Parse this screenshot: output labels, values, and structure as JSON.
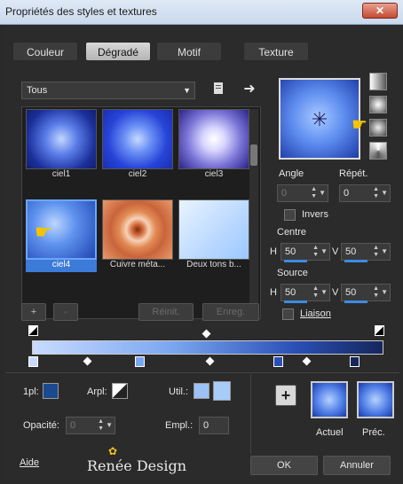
{
  "window": {
    "title": "Propriétés des styles et textures",
    "close": "✕"
  },
  "tabs": [
    "Couleur",
    "Dégradé",
    "Motif",
    "Texture"
  ],
  "category": {
    "value": "Tous"
  },
  "gallery": {
    "items": [
      {
        "label": "ciel1"
      },
      {
        "label": "ciel2"
      },
      {
        "label": "ciel3"
      },
      {
        "label": "ciel4"
      },
      {
        "label": "Cuivre méta..."
      },
      {
        "label": "Deux tons b..."
      }
    ]
  },
  "gallery_buttons": {
    "add": "+",
    "remove": "-",
    "reset": "Réinit.",
    "save": "Enreg."
  },
  "settings": {
    "angle_label": "Angle",
    "angle_value": "0",
    "repeat_label": "Répét.",
    "repeat_value": "0",
    "invert_label": "Invers",
    "center_label": "Centre",
    "h_label": "H",
    "v_label": "V",
    "center_h": "50",
    "center_v": "50",
    "source_label": "Source",
    "source_h": "50",
    "source_v": "50",
    "link_label": "Liaison"
  },
  "bottom": {
    "layer_label": "1pl:",
    "arpl_label": "Arpl:",
    "util_label": "Util.:",
    "opacity_label": "Opacité:",
    "opacity_value": "0",
    "empl_label": "Empl.:",
    "empl_value": "0",
    "current_label": "Actuel",
    "previous_label": "Préc.",
    "add_symbol": "+"
  },
  "footer": {
    "help": "Aide",
    "ok": "OK",
    "cancel": "Annuler",
    "watermark": "Renée Design"
  }
}
